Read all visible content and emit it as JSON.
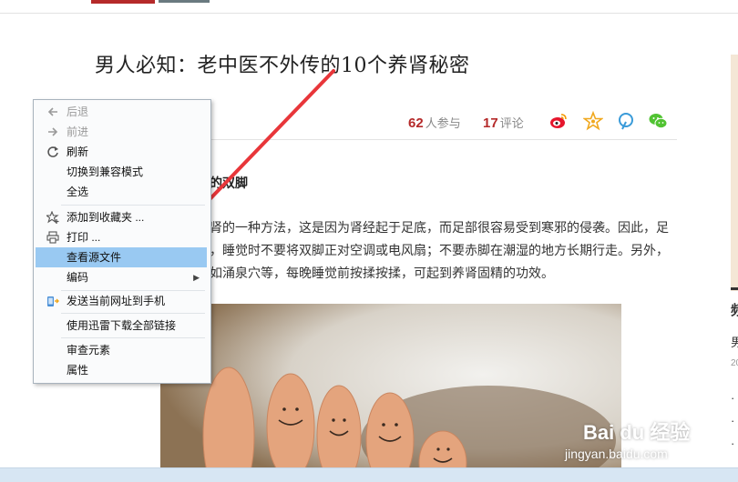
{
  "article": {
    "title": "男人必知：老中医不外传的10个养肾秘密",
    "participants_num": "62",
    "participants_label": "人参与",
    "comments_num": "17",
    "comments_label": "评论",
    "section_head": "的双脚",
    "paragraph_lines": [
      "肾的一种方法，这是因为肾经起于足底，而足部很容易受到寒邪的侵袭。因此，足",
      "，睡觉时不要将双脚正对空调或电风扇；不要赤脚在潮湿的地方长期行走。另外，",
      "如涌泉穴等，每晚睡觉前按揉按揉，可起到养肾固精的功效。"
    ]
  },
  "right_column": {
    "chars": [
      "频",
      "男",
      "20",
      "·",
      "·",
      "·"
    ]
  },
  "context_menu": {
    "items": [
      {
        "label": "后退",
        "icon": "back-arrow-icon",
        "disabled": true
      },
      {
        "label": "前进",
        "icon": "forward-arrow-icon",
        "disabled": true
      },
      {
        "label": "刷新",
        "icon": "refresh-icon",
        "disabled": false
      },
      {
        "label": "切换到兼容模式",
        "icon": "",
        "disabled": false
      },
      {
        "label": "全选",
        "icon": "",
        "disabled": false
      },
      {
        "label": "添加到收藏夹 ...",
        "icon": "star-add-icon",
        "disabled": false
      },
      {
        "label": "打印 ...",
        "icon": "printer-icon",
        "disabled": false
      },
      {
        "label": "查看源文件",
        "icon": "",
        "disabled": false,
        "highlighted": true
      },
      {
        "label": "编码",
        "icon": "",
        "disabled": false,
        "submenu": true
      },
      {
        "label": "发送当前网址到手机",
        "icon": "phone-send-icon",
        "disabled": false
      },
      {
        "label": "使用迅雷下载全部链接",
        "icon": "",
        "disabled": false
      },
      {
        "label": "审查元素",
        "icon": "",
        "disabled": false
      },
      {
        "label": "属性",
        "icon": "",
        "disabled": false
      }
    ],
    "highlight_color": "#99c9f2"
  },
  "watermark": {
    "line1": "Bai du 经验",
    "line2": "jingyan.baidu.com"
  },
  "colors": {
    "accent_red": "#b52a2a",
    "annotation_arrow": "#e8363a"
  }
}
